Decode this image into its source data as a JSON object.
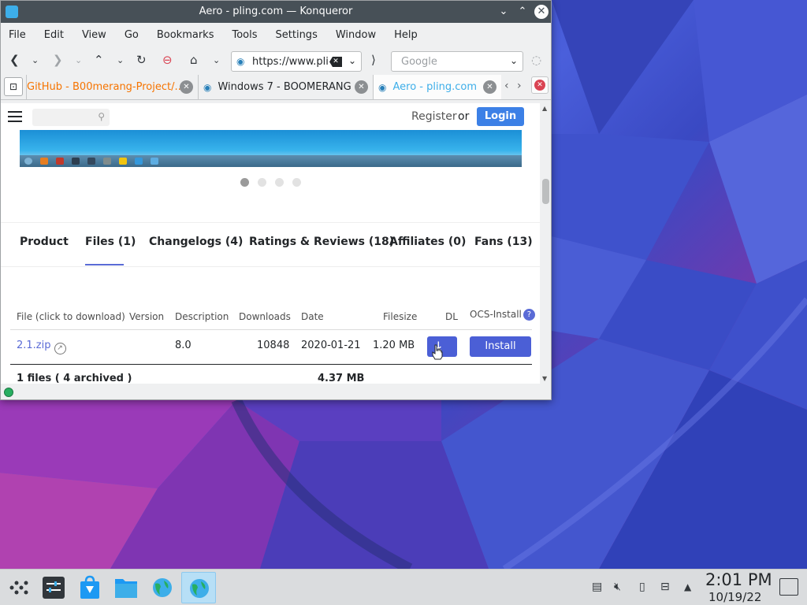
{
  "window": {
    "title": "Aero - pling.com — Konqueror"
  },
  "menubar": [
    "File",
    "Edit",
    "View",
    "Go",
    "Bookmarks",
    "Tools",
    "Settings",
    "Window",
    "Help"
  ],
  "toolbar": {
    "url": "https://www.plir",
    "search_placeholder": "Google"
  },
  "tabs": [
    {
      "label": "GitHub - B00merang-Project/..."
    },
    {
      "label": "Windows 7 - BOOMERANG"
    },
    {
      "label": "Aero - pling.com"
    }
  ],
  "site": {
    "register": "Register",
    "or": "or",
    "login": "Login"
  },
  "product_tabs": [
    "Product",
    "Files (1)",
    "Changelogs (4)",
    "Ratings & Reviews (18)",
    "Affiliates (0)",
    "Fans (13)"
  ],
  "files_table": {
    "headers": {
      "file": "File (click to download)",
      "version": "Version",
      "description": "Description",
      "downloads": "Downloads",
      "date": "Date",
      "filesize": "Filesize",
      "dl": "DL",
      "ocs": "OCS-Install"
    },
    "row": {
      "file": "2.1.zip",
      "version": "",
      "description": "8.0",
      "downloads": "10848",
      "date": "2020-01-21",
      "filesize": "1.20 MB",
      "install": "Install"
    },
    "footer": {
      "count": "1 files ( 4 archived )",
      "total": "4.37 MB"
    }
  },
  "taskbar": {
    "time": "2:01 PM",
    "date": "10/19/22"
  },
  "colors": {
    "accent": "#5a6bd6",
    "login": "#3c80e6",
    "titlebar": "#475057",
    "active_tab": "#3daee9",
    "first_tab": "#f67400"
  }
}
